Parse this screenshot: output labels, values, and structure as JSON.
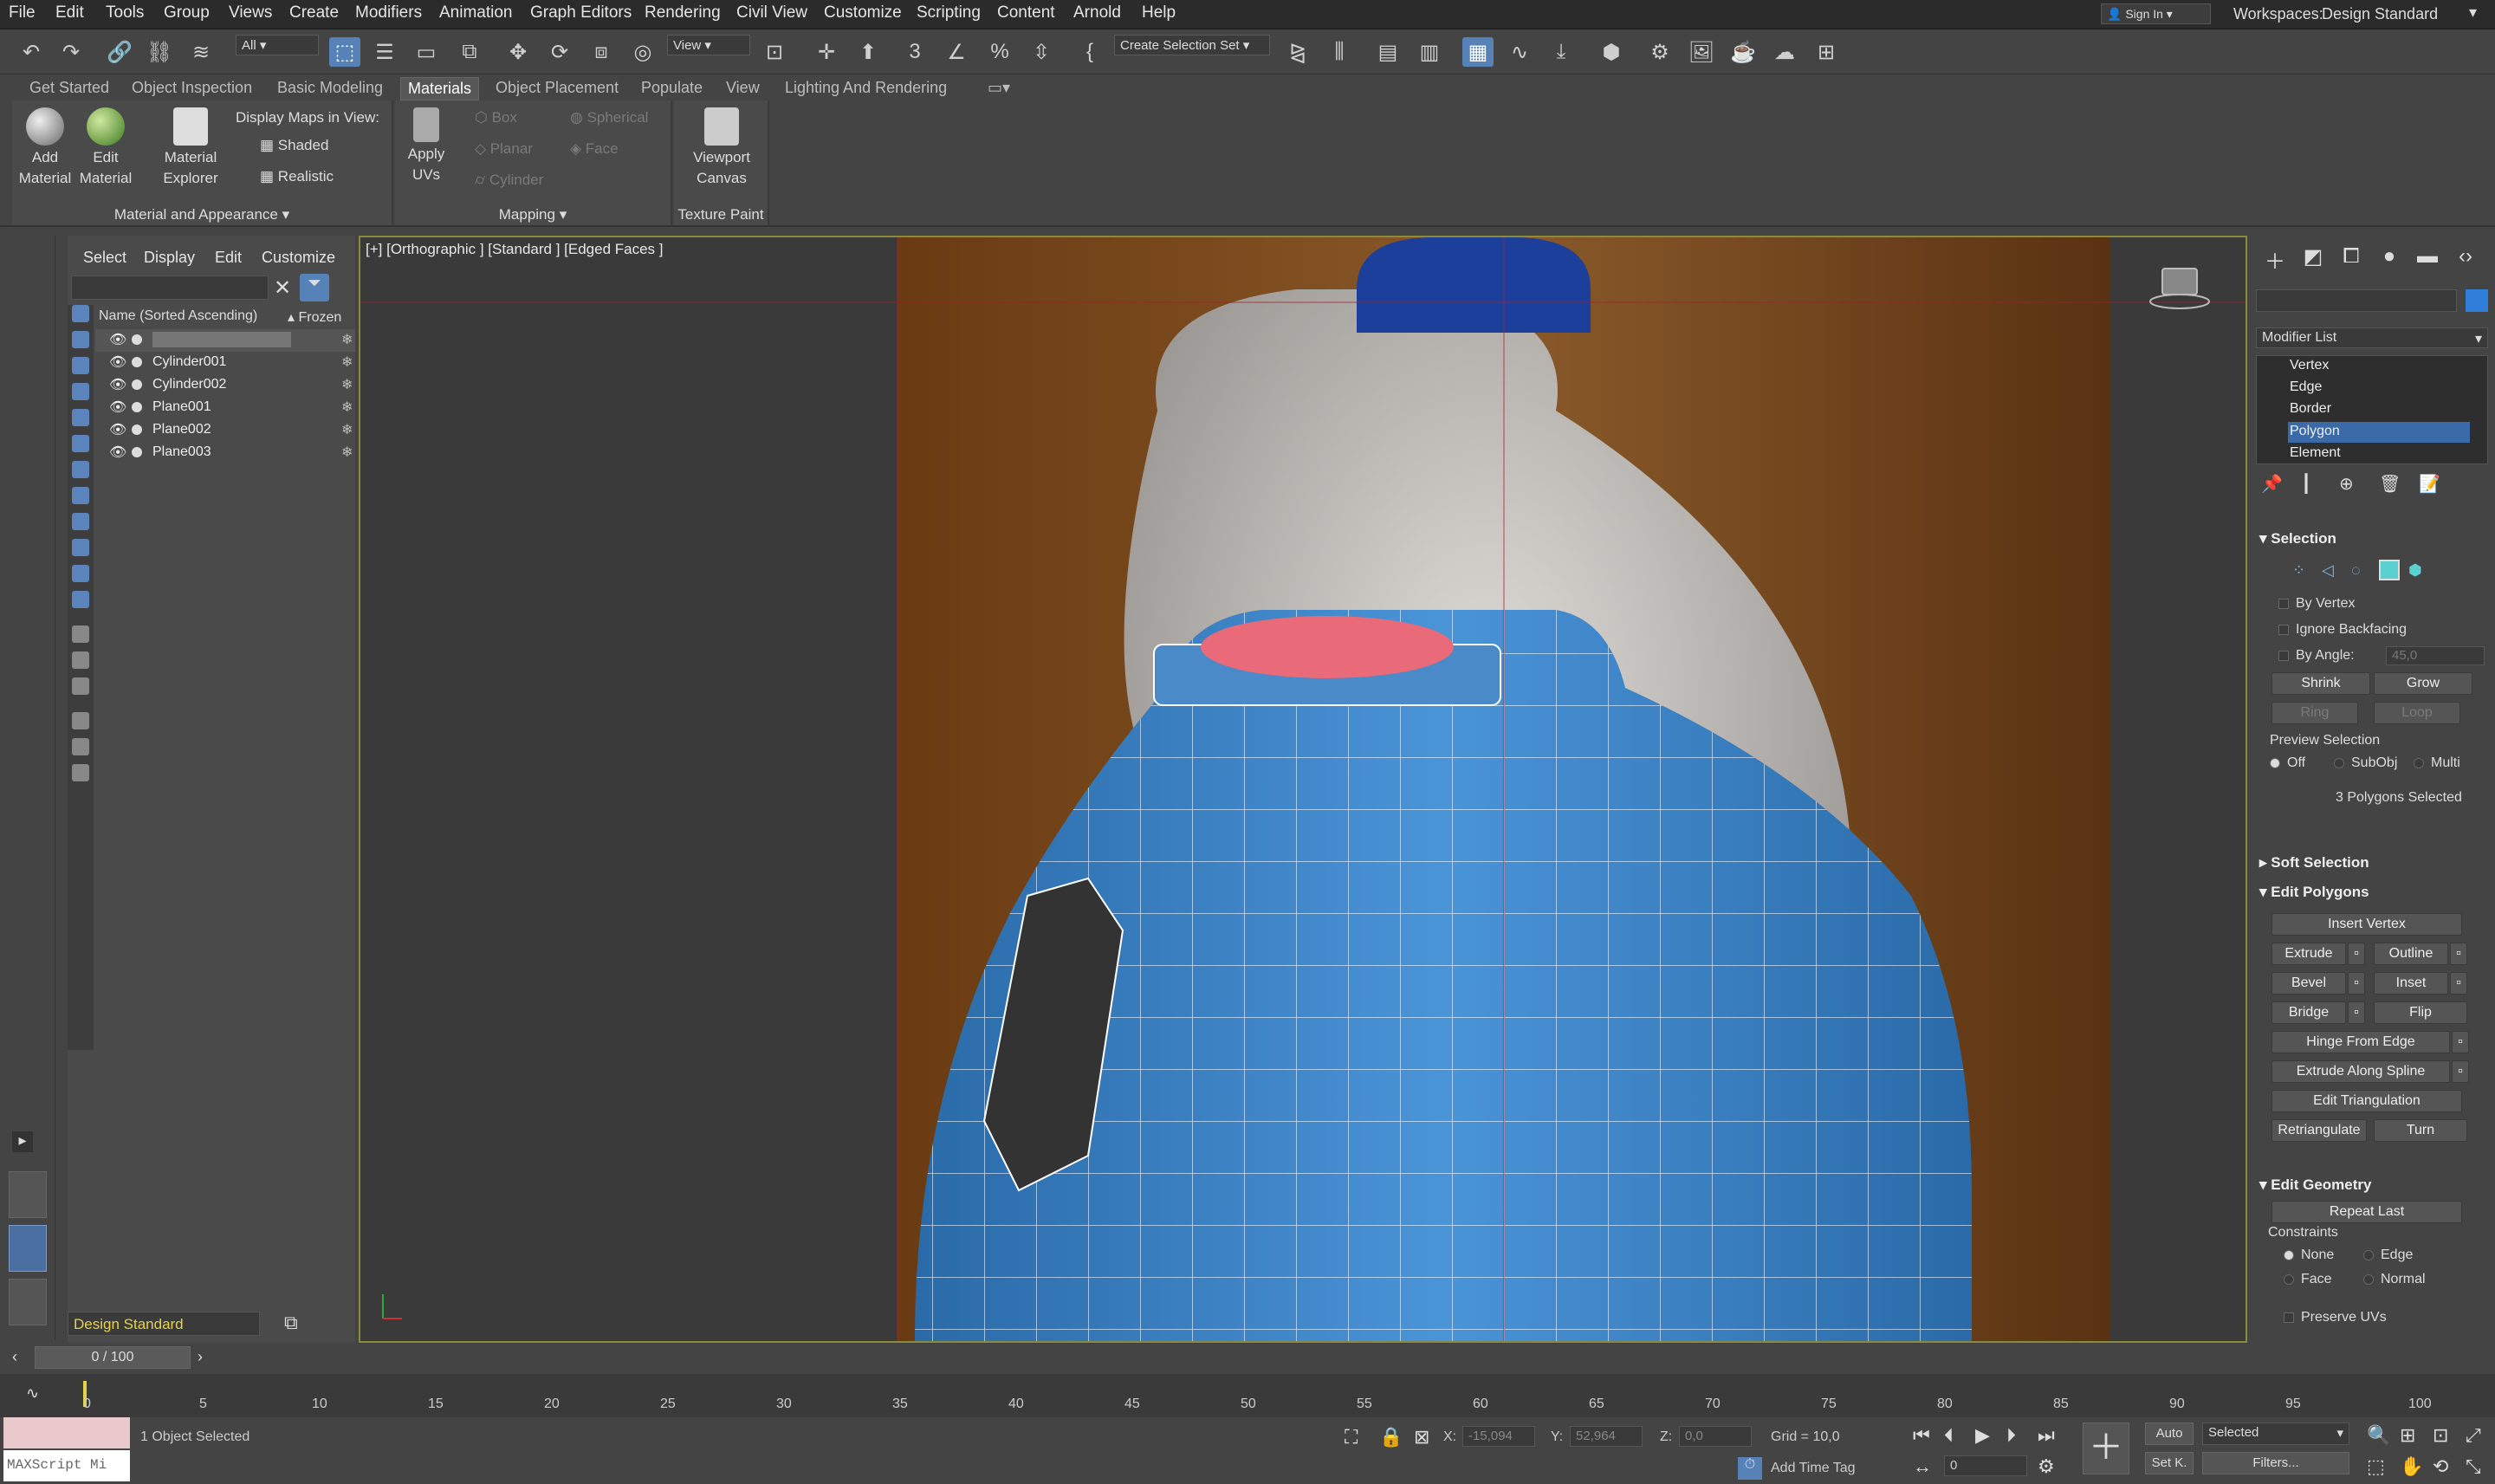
{
  "menu": [
    "File",
    "Edit",
    "Tools",
    "Group",
    "Views",
    "Create",
    "Modifiers",
    "Animation",
    "Graph Editors",
    "Rendering",
    "Civil View",
    "Customize",
    "Scripting",
    "Content",
    "Arnold",
    "Help"
  ],
  "account": {
    "signin": "Sign In",
    "workspaces_label": "Workspaces:",
    "workspace": "Design Standard"
  },
  "toolbar": {
    "filter": "All",
    "ref_coord": "View",
    "selection_set": "Create Selection Set"
  },
  "ribbon_tabs": [
    "Get Started",
    "Object Inspection",
    "Basic Modeling",
    "Materials",
    "Object Placement",
    "Populate",
    "View",
    "Lighting And Rendering"
  ],
  "ribbon": {
    "add_material": [
      "Add",
      "Material"
    ],
    "edit_material": [
      "Edit",
      "Material"
    ],
    "material_explorer": [
      "Material",
      "Explorer"
    ],
    "display_maps": "Display Maps in View:",
    "shaded": "Shaded",
    "realistic": "Realistic",
    "group1": "Material and Appearance",
    "apply_uvs": [
      "Apply",
      "UVs"
    ],
    "box": "Box",
    "planar": "Planar",
    "cylinder": "Cylinder",
    "spherical": "Spherical",
    "face": "Face",
    "group2": "Mapping",
    "viewport_canvas": [
      "Viewport",
      "Canvas"
    ],
    "group3": "Texture Paint"
  },
  "scene_explorer": {
    "menu": [
      "Select",
      "Display",
      "Edit",
      "Customize"
    ],
    "col_name": "Name (Sorted Ascending)",
    "col_frozen": "▴ Frozen",
    "rows": [
      "",
      "Cylinder001",
      "Cylinder002",
      "Plane001",
      "Plane002",
      "Plane003"
    ],
    "workspace": "Design Standard"
  },
  "viewport": {
    "label": "[+] [Orthographic ] [Standard ] [Edged Faces ]"
  },
  "modifier": {
    "list_label": "Modifier List",
    "subobjects": [
      "Vertex",
      "Edge",
      "Border",
      "Polygon",
      "Element"
    ],
    "selected": "Polygon",
    "selection": "Selection",
    "by_vertex": "By Vertex",
    "ignore_backfacing": "Ignore Backfacing",
    "by_angle": "By Angle:",
    "angle": "45,0",
    "shrink": "Shrink",
    "grow": "Grow",
    "ring": "Ring",
    "loop": "Loop",
    "preview": "Preview Selection",
    "off": "Off",
    "subobj": "SubObj",
    "multi": "Multi",
    "status": "3 Polygons Selected",
    "soft_selection": "Soft Selection",
    "edit_polygons": "Edit Polygons",
    "insert_vertex": "Insert Vertex",
    "extrude": "Extrude",
    "outline": "Outline",
    "bevel": "Bevel",
    "inset": "Inset",
    "bridge": "Bridge",
    "flip": "Flip",
    "hinge": "Hinge From Edge",
    "extrude_spline": "Extrude Along Spline",
    "edit_triangulation": "Edit Triangulation",
    "retriangulate": "Retriangulate",
    "turn": "Turn",
    "edit_geometry": "Edit Geometry",
    "repeat_last": "Repeat Last",
    "constraints": "Constraints",
    "none": "None",
    "edge": "Edge",
    "face": "Face",
    "normal": "Normal",
    "preserve_uvs": "Preserve UVs"
  },
  "timeline": {
    "frame": "0 / 100",
    "ticks": [
      "0",
      "5",
      "10",
      "15",
      "20",
      "25",
      "30",
      "35",
      "40",
      "45",
      "50",
      "55",
      "60",
      "65",
      "70",
      "75",
      "80",
      "85",
      "90",
      "95",
      "100"
    ]
  },
  "status": {
    "maxscript": "MAXScript Mi",
    "selected": "1 Object Selected",
    "x_label": "X:",
    "x": "-15,094",
    "y_label": "Y:",
    "y": "52,964",
    "z_label": "Z:",
    "z": "0,0",
    "grid": "Grid = 10,0",
    "add_time_tag": "Add Time Tag",
    "auto": "Auto",
    "set_key": "Set K.",
    "key_mode": "Selected",
    "filters": "Filters...",
    "frame_field": "0"
  },
  "colors": {
    "accent": "#5682b8",
    "bottle_mesh": "#3a7fc2",
    "cap": "#e96a78",
    "backdrop": "#8a5a2a"
  }
}
